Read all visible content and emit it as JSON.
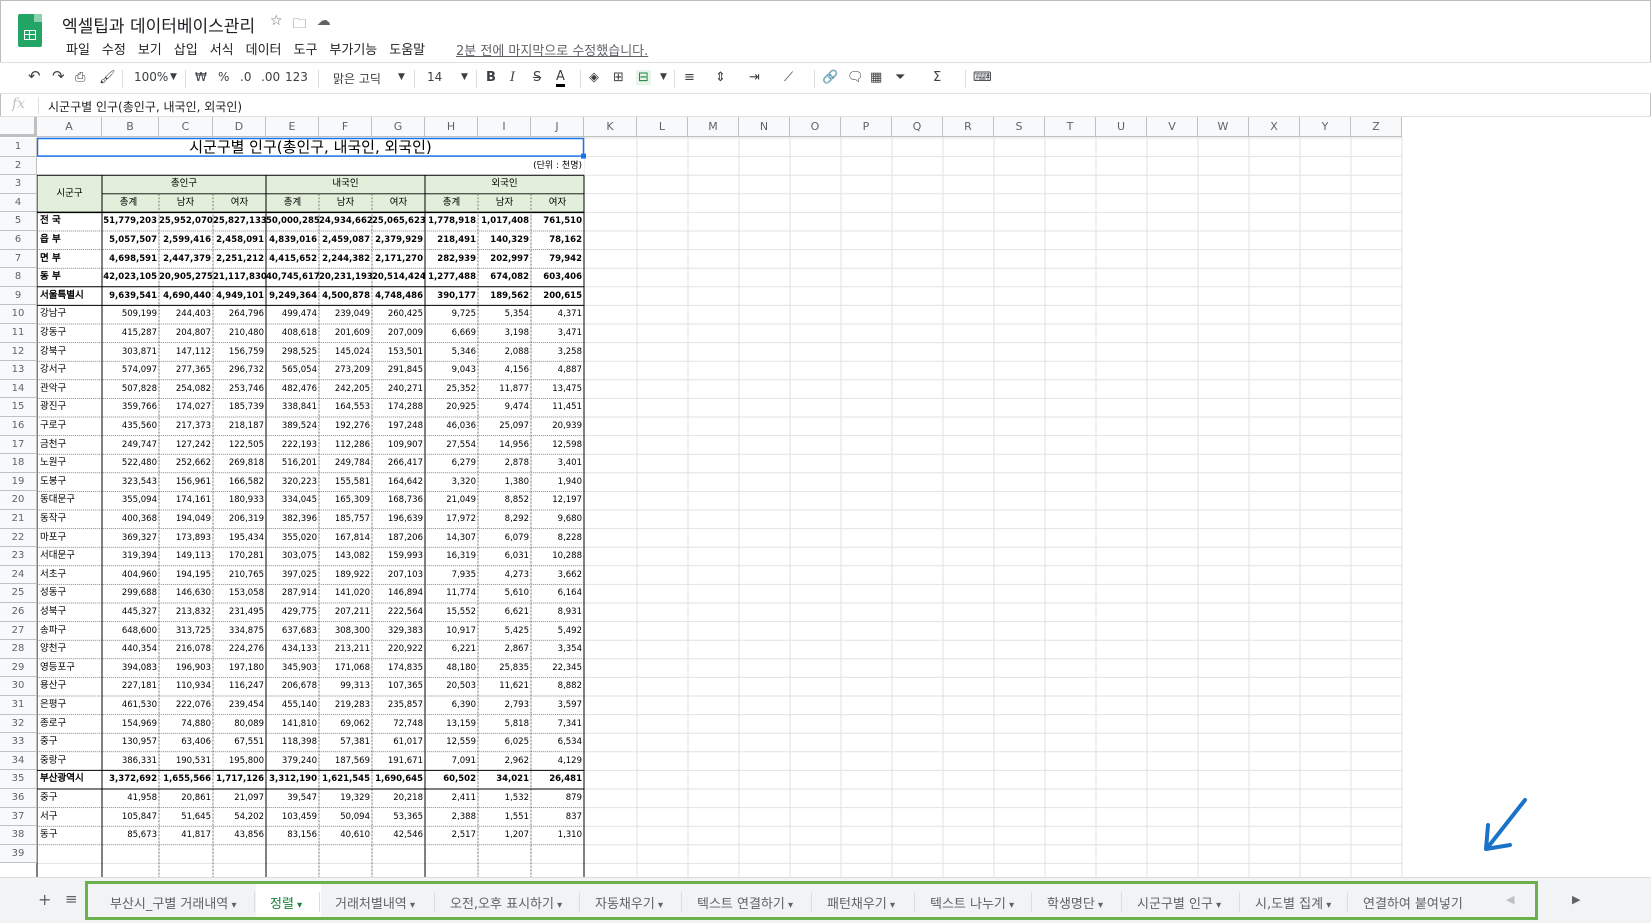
{
  "app": {
    "title": "엑셀팁과 데이터베이스관리",
    "last_edit": "2분 전에 마지막으로 수정했습니다.",
    "menu": [
      "파일",
      "수정",
      "보기",
      "삽입",
      "서식",
      "데이터",
      "도구",
      "부가기능",
      "도움말"
    ]
  },
  "toolbar": {
    "zoom": "100%",
    "currency": "₩",
    "percent": "%",
    "dec_less": ".0",
    "dec_more": ".00",
    "format_more": "123",
    "font": "맑은 고딕",
    "font_size": "14",
    "bold": "B",
    "italic": "I",
    "strike": "S",
    "text_color": "A",
    "sum": "Σ"
  },
  "formula_bar": {
    "fx": "fx",
    "value": "시군구별 인구(총인구, 내국인, 외국인)"
  },
  "columns": [
    "A",
    "B",
    "C",
    "D",
    "E",
    "F",
    "G",
    "H",
    "I",
    "J",
    "K",
    "L",
    "M",
    "N",
    "O",
    "P",
    "Q",
    "R",
    "S",
    "T",
    "U",
    "V",
    "W",
    "X",
    "Y",
    "Z"
  ],
  "sheet": {
    "title": "시군구별 인구(총인구, 내국인, 외국인)",
    "unit": "(단위 : 천명)",
    "header_region": "시군구",
    "groups": [
      "총인구",
      "내국인",
      "외국인"
    ],
    "sub": [
      "총계",
      "남자",
      "여자"
    ],
    "rows": [
      [
        "전  국",
        "51,779,203",
        "25,952,070",
        "25,827,133",
        "50,000,285",
        "24,934,662",
        "25,065,623",
        "1,778,918",
        "1,017,408",
        "761,510"
      ],
      [
        "읍  부",
        "5,057,507",
        "2,599,416",
        "2,458,091",
        "4,839,016",
        "2,459,087",
        "2,379,929",
        "218,491",
        "140,329",
        "78,162"
      ],
      [
        "면  부",
        "4,698,591",
        "2,447,379",
        "2,251,212",
        "4,415,652",
        "2,244,382",
        "2,171,270",
        "282,939",
        "202,997",
        "79,942"
      ],
      [
        "동  부",
        "42,023,105",
        "20,905,275",
        "21,117,830",
        "40,745,617",
        "20,231,193",
        "20,514,424",
        "1,277,488",
        "674,082",
        "603,406"
      ],
      [
        "서울특별시",
        "9,639,541",
        "4,690,440",
        "4,949,101",
        "9,249,364",
        "4,500,878",
        "4,748,486",
        "390,177",
        "189,562",
        "200,615"
      ],
      [
        "강남구",
        "509,199",
        "244,403",
        "264,796",
        "499,474",
        "239,049",
        "260,425",
        "9,725",
        "5,354",
        "4,371"
      ],
      [
        "강동구",
        "415,287",
        "204,807",
        "210,480",
        "408,618",
        "201,609",
        "207,009",
        "6,669",
        "3,198",
        "3,471"
      ],
      [
        "강북구",
        "303,871",
        "147,112",
        "156,759",
        "298,525",
        "145,024",
        "153,501",
        "5,346",
        "2,088",
        "3,258"
      ],
      [
        "강서구",
        "574,097",
        "277,365",
        "296,732",
        "565,054",
        "273,209",
        "291,845",
        "9,043",
        "4,156",
        "4,887"
      ],
      [
        "관악구",
        "507,828",
        "254,082",
        "253,746",
        "482,476",
        "242,205",
        "240,271",
        "25,352",
        "11,877",
        "13,475"
      ],
      [
        "광진구",
        "359,766",
        "174,027",
        "185,739",
        "338,841",
        "164,553",
        "174,288",
        "20,925",
        "9,474",
        "11,451"
      ],
      [
        "구로구",
        "435,560",
        "217,373",
        "218,187",
        "389,524",
        "192,276",
        "197,248",
        "46,036",
        "25,097",
        "20,939"
      ],
      [
        "금천구",
        "249,747",
        "127,242",
        "122,505",
        "222,193",
        "112,286",
        "109,907",
        "27,554",
        "14,956",
        "12,598"
      ],
      [
        "노원구",
        "522,480",
        "252,662",
        "269,818",
        "516,201",
        "249,784",
        "266,417",
        "6,279",
        "2,878",
        "3,401"
      ],
      [
        "도봉구",
        "323,543",
        "156,961",
        "166,582",
        "320,223",
        "155,581",
        "164,642",
        "3,320",
        "1,380",
        "1,940"
      ],
      [
        "동대문구",
        "355,094",
        "174,161",
        "180,933",
        "334,045",
        "165,309",
        "168,736",
        "21,049",
        "8,852",
        "12,197"
      ],
      [
        "동작구",
        "400,368",
        "194,049",
        "206,319",
        "382,396",
        "185,757",
        "196,639",
        "17,972",
        "8,292",
        "9,680"
      ],
      [
        "마포구",
        "369,327",
        "173,893",
        "195,434",
        "355,020",
        "167,814",
        "187,206",
        "14,307",
        "6,079",
        "8,228"
      ],
      [
        "서대문구",
        "319,394",
        "149,113",
        "170,281",
        "303,075",
        "143,082",
        "159,993",
        "16,319",
        "6,031",
        "10,288"
      ],
      [
        "서초구",
        "404,960",
        "194,195",
        "210,765",
        "397,025",
        "189,922",
        "207,103",
        "7,935",
        "4,273",
        "3,662"
      ],
      [
        "성동구",
        "299,688",
        "146,630",
        "153,058",
        "287,914",
        "141,020",
        "146,894",
        "11,774",
        "5,610",
        "6,164"
      ],
      [
        "성북구",
        "445,327",
        "213,832",
        "231,495",
        "429,775",
        "207,211",
        "222,564",
        "15,552",
        "6,621",
        "8,931"
      ],
      [
        "송파구",
        "648,600",
        "313,725",
        "334,875",
        "637,683",
        "308,300",
        "329,383",
        "10,917",
        "5,425",
        "5,492"
      ],
      [
        "양천구",
        "440,354",
        "216,078",
        "224,276",
        "434,133",
        "213,211",
        "220,922",
        "6,221",
        "2,867",
        "3,354"
      ],
      [
        "영등포구",
        "394,083",
        "196,903",
        "197,180",
        "345,903",
        "171,068",
        "174,835",
        "48,180",
        "25,835",
        "22,345"
      ],
      [
        "용산구",
        "227,181",
        "110,934",
        "116,247",
        "206,678",
        "99,313",
        "107,365",
        "20,503",
        "11,621",
        "8,882"
      ],
      [
        "은평구",
        "461,530",
        "222,076",
        "239,454",
        "455,140",
        "219,283",
        "235,857",
        "6,390",
        "2,793",
        "3,597"
      ],
      [
        "종로구",
        "154,969",
        "74,880",
        "80,089",
        "141,810",
        "69,062",
        "72,748",
        "13,159",
        "5,818",
        "7,341"
      ],
      [
        "중구",
        "130,957",
        "63,406",
        "67,551",
        "118,398",
        "57,381",
        "61,017",
        "12,559",
        "6,025",
        "6,534"
      ],
      [
        "중랑구",
        "386,331",
        "190,531",
        "195,800",
        "379,240",
        "187,569",
        "191,671",
        "7,091",
        "2,962",
        "4,129"
      ],
      [
        "부산광역시",
        "3,372,692",
        "1,655,566",
        "1,717,126",
        "3,312,190",
        "1,621,545",
        "1,690,645",
        "60,502",
        "34,021",
        "26,481"
      ],
      [
        "중구",
        "41,958",
        "20,861",
        "21,097",
        "39,547",
        "19,329",
        "20,218",
        "2,411",
        "1,532",
        "879"
      ],
      [
        "서구",
        "105,847",
        "51,645",
        "54,202",
        "103,459",
        "50,094",
        "53,365",
        "2,388",
        "1,551",
        "837"
      ],
      [
        "동구",
        "85,673",
        "41,817",
        "43,856",
        "83,156",
        "40,610",
        "42,546",
        "2,517",
        "1,207",
        "1,310"
      ]
    ]
  },
  "sheet_tabs": [
    {
      "label": "부산시_구별 거래내역"
    },
    {
      "label": "정렬",
      "active": true
    },
    {
      "label": "거래처별내역"
    },
    {
      "label": "오전,오후 표시하기"
    },
    {
      "label": "자동채우기"
    },
    {
      "label": "텍스트 연결하기"
    },
    {
      "label": "패턴채우기"
    },
    {
      "label": "텍스트 나누기"
    },
    {
      "label": "학생명단"
    },
    {
      "label": "시군구별 인구"
    },
    {
      "label": "시,도별 집계"
    },
    {
      "label": "연결하여 붙여넣기"
    }
  ],
  "sheet_controls": {
    "add": "+",
    "list": "≡",
    "prev": "◀",
    "next": "▶"
  },
  "colors": {
    "accent_green": "#6ab04c",
    "header_fill": "#e2efda",
    "sheets_green": "#23a566",
    "arrow_blue": "#1a73c8"
  }
}
